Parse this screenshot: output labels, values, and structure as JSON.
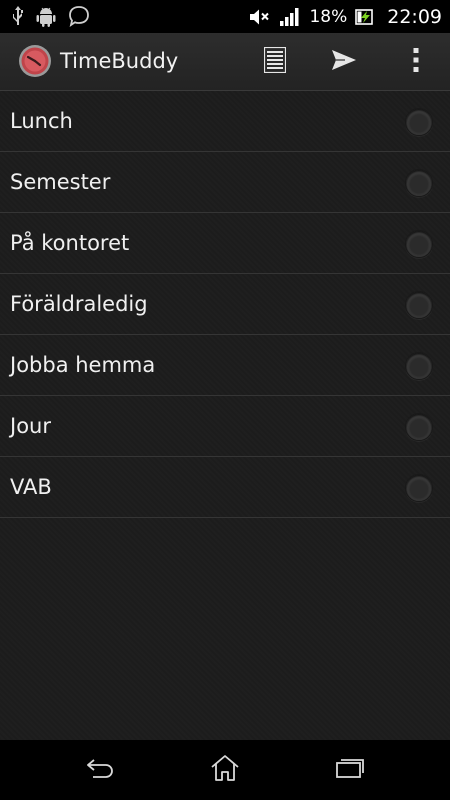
{
  "status_bar": {
    "icons": [
      "usb-icon",
      "android-debug-icon",
      "chat-bubble-icon",
      "mute-icon",
      "signal-icon",
      "battery-charging-icon"
    ],
    "battery_percent": "18%",
    "time": "22:09"
  },
  "action_bar": {
    "title": "TimeBuddy",
    "logo_icon": "clock-icon",
    "actions": [
      "list-icon",
      "send-icon",
      "overflow-menu-icon"
    ]
  },
  "list": {
    "items": [
      {
        "label": "Lunch",
        "selected": false
      },
      {
        "label": "Semester",
        "selected": false
      },
      {
        "label": "På kontoret",
        "selected": false
      },
      {
        "label": "Föräldraledig",
        "selected": false
      },
      {
        "label": "Jobba hemma",
        "selected": false
      },
      {
        "label": "Jour",
        "selected": false
      },
      {
        "label": "VAB",
        "selected": false
      }
    ]
  },
  "nav_bar": {
    "buttons": [
      "back-icon",
      "home-icon",
      "recent-apps-icon"
    ]
  },
  "colors": {
    "background": "#1c1c1c",
    "action_bar": "#2a2a2a",
    "text": "#f0f0f0",
    "divider": "#353535",
    "logo_red": "#c0444a"
  }
}
